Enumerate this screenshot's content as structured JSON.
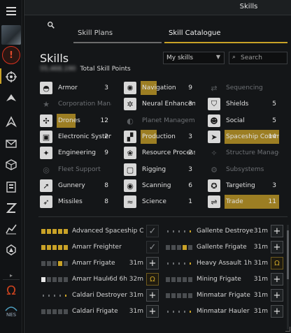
{
  "window": {
    "title": "Skills"
  },
  "tabs": [
    {
      "label": "Skill Plans"
    },
    {
      "label": "Skill Catalogue"
    }
  ],
  "heading": "Skills",
  "total_sp": {
    "value": "55,468,190",
    "label": "Total Skill Points"
  },
  "filter": {
    "selected": "My skills"
  },
  "search": {
    "placeholder": "Search"
  },
  "categories": [
    {
      "name": "Armor",
      "level": "3",
      "icon": "armor-icon",
      "glyph": "◓",
      "dim": false
    },
    {
      "name": "Corporation Management",
      "level": "",
      "icon": "corporation-icon",
      "glyph": "★",
      "dim": true
    },
    {
      "name": "Drones",
      "level": "12",
      "icon": "drones-icon",
      "glyph": "✣",
      "dim": false,
      "bar": 0.35
    },
    {
      "name": "Electronic Systems",
      "level": "2",
      "icon": "electronic-systems-icon",
      "glyph": "▣",
      "dim": false
    },
    {
      "name": "Engineering",
      "level": "9",
      "icon": "engineering-icon",
      "glyph": "✦",
      "dim": false
    },
    {
      "name": "Fleet Support",
      "level": "",
      "icon": "fleet-support-icon",
      "glyph": "◎",
      "dim": true
    },
    {
      "name": "Gunnery",
      "level": "8",
      "icon": "gunnery-icon",
      "glyph": "➚",
      "dim": false
    },
    {
      "name": "Missiles",
      "level": "8",
      "icon": "missiles-icon",
      "glyph": "➶",
      "dim": false
    },
    {
      "name": "Navigation",
      "level": "9",
      "icon": "navigation-icon",
      "glyph": "✺",
      "dim": false,
      "bar": 0.3
    },
    {
      "name": "Neural Enhancement",
      "level": "3",
      "icon": "neural-enhancement-icon",
      "glyph": "✲",
      "dim": false
    },
    {
      "name": "Planet Management",
      "level": "",
      "icon": "planet-management-icon",
      "glyph": "◐",
      "dim": true
    },
    {
      "name": "Production",
      "level": "3",
      "icon": "production-icon",
      "glyph": "▞",
      "dim": false,
      "bar": 0.3
    },
    {
      "name": "Resource Processing",
      "level": "2",
      "icon": "resource-processing-icon",
      "glyph": "❀",
      "dim": false
    },
    {
      "name": "Rigging",
      "level": "3",
      "icon": "rigging-icon",
      "glyph": "▢",
      "dim": false
    },
    {
      "name": "Scanning",
      "level": "6",
      "icon": "scanning-icon",
      "glyph": "◉",
      "dim": false
    },
    {
      "name": "Science",
      "level": "1",
      "icon": "science-icon",
      "glyph": "≈",
      "dim": false
    },
    {
      "name": "Sequencing",
      "level": "",
      "icon": "sequencing-icon",
      "glyph": "⇄",
      "dim": true
    },
    {
      "name": "Shields",
      "level": "5",
      "icon": "shields-icon",
      "glyph": "⛉",
      "dim": false
    },
    {
      "name": "Social",
      "level": "5",
      "icon": "social-icon",
      "glyph": "☻",
      "dim": false
    },
    {
      "name": "Spaceship Command",
      "level": "14",
      "icon": "spaceship-command-icon",
      "glyph": "➤",
      "dim": false,
      "bar": 1.0
    },
    {
      "name": "Structure Management",
      "level": "",
      "icon": "structure-management-icon",
      "glyph": "✧",
      "dim": true
    },
    {
      "name": "Subsystems",
      "level": "",
      "icon": "subsystems-icon",
      "glyph": "⚙",
      "dim": true
    },
    {
      "name": "Targeting",
      "level": "3",
      "icon": "targeting-icon",
      "glyph": "✪",
      "dim": false
    },
    {
      "name": "Trade",
      "level": "11",
      "icon": "trade-icon",
      "glyph": "⇌",
      "dim": false,
      "bar": 1.0
    }
  ],
  "skills_left": [
    {
      "name": "Advanced Spaceship Command",
      "time": "",
      "levels": [
        1,
        1,
        1,
        1,
        1
      ],
      "action": "done"
    },
    {
      "name": "Amarr Freighter",
      "time": "",
      "levels": [
        1,
        1,
        1,
        1,
        1
      ],
      "action": "done"
    },
    {
      "name": "Amarr Frigate",
      "time": "31m",
      "levels": [
        2,
        2,
        2,
        1,
        0
      ],
      "action": "add"
    },
    {
      "name": "Amarr Hauler",
      "time": "6d 6h 32m",
      "levels": [
        3,
        2,
        2,
        2,
        0
      ],
      "action": "omega"
    },
    {
      "name": "Caldari Destroyer",
      "time": "31m",
      "levels": [
        4,
        4,
        4,
        4,
        5
      ],
      "action": "add"
    },
    {
      "name": "Caldari Frigate",
      "time": "31m",
      "levels": [
        2,
        2,
        2,
        2,
        0
      ],
      "action": "add"
    }
  ],
  "skills_right": [
    {
      "name": "Gallente Destroyer",
      "time": "31m",
      "levels": [
        4,
        4,
        4,
        4,
        5
      ],
      "action": "add"
    },
    {
      "name": "Gallente Frigate",
      "time": "31m",
      "levels": [
        2,
        2,
        2,
        1,
        0
      ],
      "action": "add"
    },
    {
      "name": "Heavy Assault Cruisers",
      "time": "1h 31m",
      "levels": [
        4,
        4,
        4,
        4,
        5
      ],
      "action": "omega"
    },
    {
      "name": "Mining Frigate",
      "time": "31m",
      "levels": [
        2,
        2,
        2,
        2,
        0
      ],
      "action": "add"
    },
    {
      "name": "Minmatar Frigate",
      "time": "31m",
      "levels": [
        2,
        2,
        2,
        2,
        0
      ],
      "action": "add"
    },
    {
      "name": "Minmatar Hauler",
      "time": "31m",
      "levels": [
        4,
        4,
        4,
        4,
        5
      ],
      "action": "add"
    }
  ]
}
